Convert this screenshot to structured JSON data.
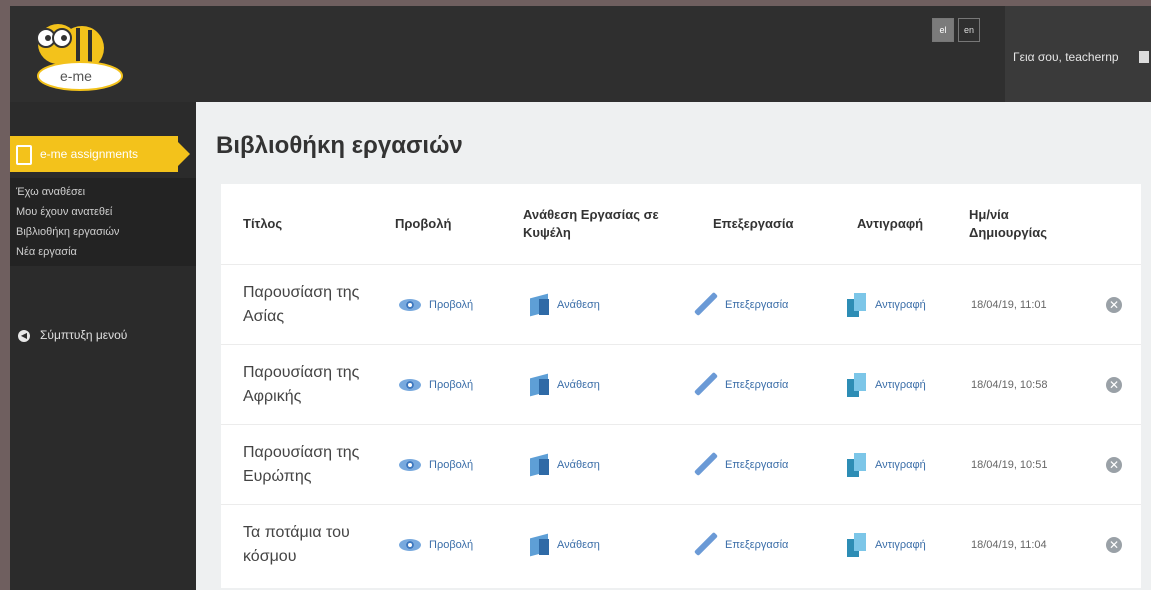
{
  "languages": {
    "el": "el",
    "en": "en"
  },
  "greeting": "Γεια σου, teachernp",
  "sidebar": {
    "active": "e-me assignments",
    "items": [
      {
        "label": "Έχω αναθέσει"
      },
      {
        "label": "Μου έχουν ανατεθεί"
      },
      {
        "label": "Βιβλιοθήκη εργασιών"
      },
      {
        "label": "Νέα εργασία"
      }
    ],
    "collapse": "Σύμπτυξη μενού"
  },
  "page_title": "Βιβλιοθήκη εργασιών",
  "table": {
    "headers": {
      "title": "Τίτλος",
      "view": "Προβολή",
      "assign": "Ανάθεση Εργασίας σε Κυψέλη",
      "edit": "Επεξεργασία",
      "copy": "Αντιγραφή",
      "date": "Ημ/νία Δημιουργίας"
    },
    "action_labels": {
      "view": "Προβολή",
      "assign": "Ανάθεση",
      "edit": "Επεξεργασία",
      "copy": "Αντιγραφή"
    },
    "rows": [
      {
        "title": "Παρουσίαση της Ασίας",
        "date": "18/04/19, 11:01"
      },
      {
        "title": "Παρουσίαση της Αφρικής",
        "date": "18/04/19, 10:58"
      },
      {
        "title": "Παρουσίαση της Ευρώπης",
        "date": "18/04/19, 10:51"
      },
      {
        "title": "Τα ποτάμια του κόσμου",
        "date": "18/04/19, 11:04"
      }
    ]
  },
  "colors": {
    "accent": "#f3c21b",
    "link": "#3b6ea8",
    "topbar": "#2f2f2f",
    "content_bg": "#eef0f1"
  }
}
